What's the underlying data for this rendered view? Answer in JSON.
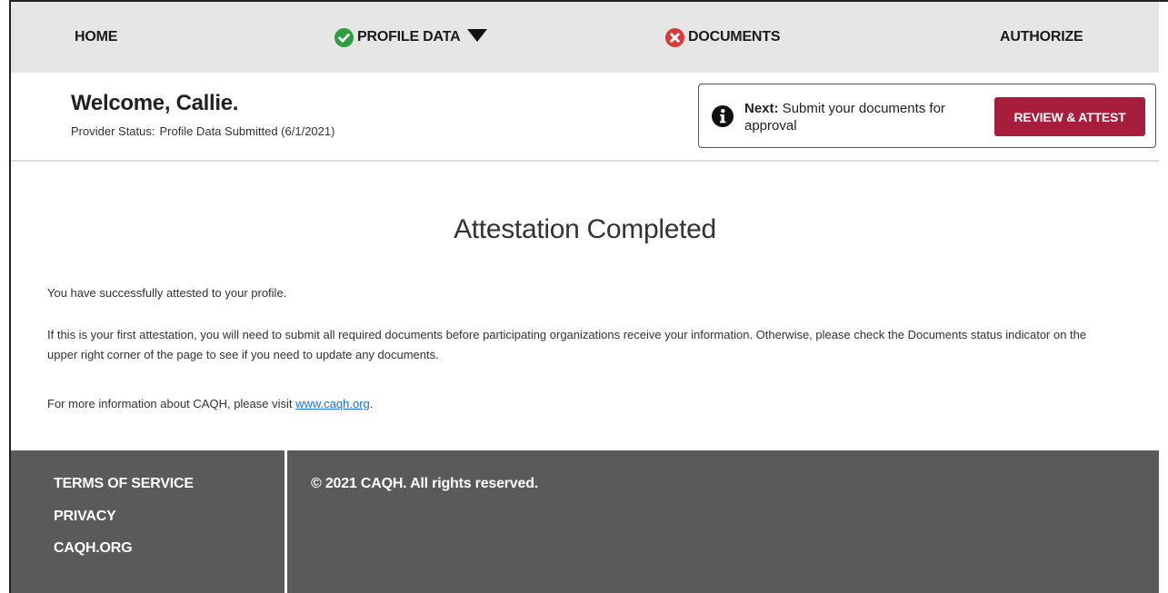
{
  "nav": {
    "home": "HOME",
    "profile_data": "PROFILE DATA",
    "documents": "DOCUMENTS",
    "authorize": "AUTHORIZE",
    "profile_status_icon": "check-circle-icon",
    "documents_status_icon": "x-circle-icon",
    "colors": {
      "complete": "#2e9e3f",
      "incomplete": "#d93a3a"
    }
  },
  "welcome": {
    "title": "Welcome, Callie.",
    "status_label": "Provider Status:",
    "status_value": "Profile Data Submitted (6/1/2021)"
  },
  "next_step": {
    "prefix": "Next:",
    "text": " Submit your documents for approval",
    "button_label": "REVIEW & ATTEST",
    "button_color": "#a61e3c"
  },
  "main": {
    "title": "Attestation Completed",
    "para1": "You have successfully attested to your profile.",
    "para2": "If this is your first attestation, you will need to submit all required documents before participating organizations receive your information. Otherwise, please check the Documents status indicator on the upper right corner of the page to see if you need to update any documents.",
    "para3_prefix": "For more information about CAQH, please visit ",
    "para3_link": "www.caqh.org",
    "para3_suffix": "."
  },
  "footer": {
    "links": [
      "TERMS OF SERVICE",
      "PRIVACY",
      "CAQH.ORG"
    ],
    "copyright": "© 2021 CAQH. All rights reserved."
  }
}
